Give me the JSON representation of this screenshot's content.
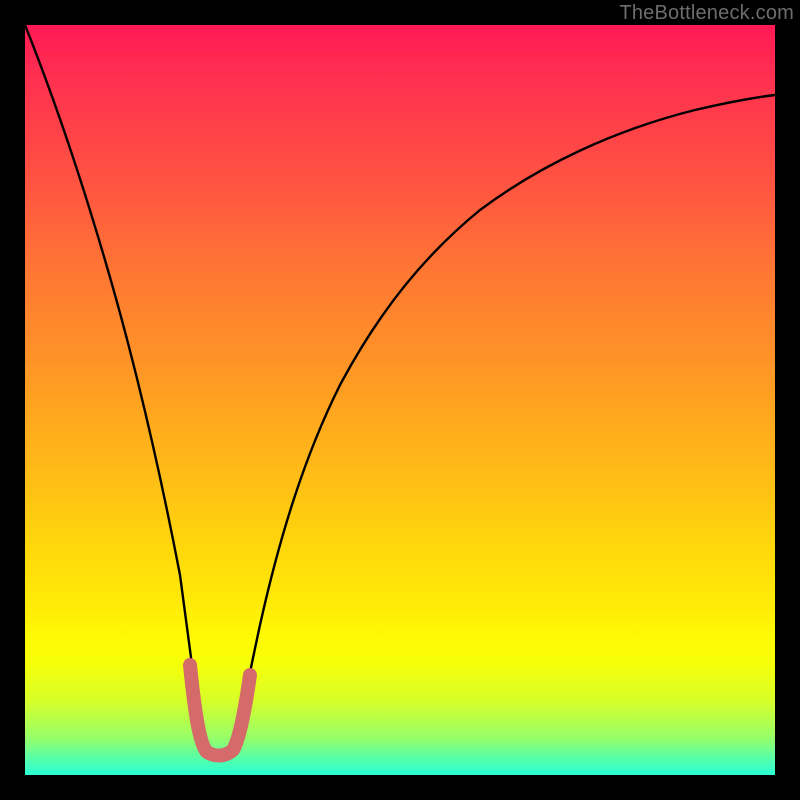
{
  "watermark": "TheBottleneck.com",
  "chart_data": {
    "type": "line",
    "title": "",
    "xlabel": "",
    "ylabel": "",
    "xlim": [
      0,
      100
    ],
    "ylim": [
      0,
      100
    ],
    "series": [
      {
        "name": "bottleneck-curve",
        "color": "#000000",
        "x": [
          0,
          8,
          14,
          18,
          22,
          23,
          24,
          25,
          26,
          27,
          28,
          30,
          34,
          40,
          48,
          56,
          64,
          74,
          86,
          100
        ],
        "values": [
          100,
          75,
          55,
          38,
          14,
          6,
          3,
          3,
          3,
          3,
          6,
          15,
          33,
          50,
          62,
          70,
          76,
          81,
          86,
          90
        ]
      },
      {
        "name": "optimal-zone",
        "color": "#d46a6a",
        "x": [
          22,
          23,
          24,
          25,
          26,
          27,
          28
        ],
        "values": [
          14,
          6,
          3,
          3,
          3,
          3,
          6
        ]
      }
    ],
    "gradient_stops": [
      {
        "pos": 0,
        "color": "#ff1955"
      },
      {
        "pos": 22,
        "color": "#ff5640"
      },
      {
        "pos": 45,
        "color": "#ff9426"
      },
      {
        "pos": 70,
        "color": "#ffd80b"
      },
      {
        "pos": 85,
        "color": "#f6ff09"
      },
      {
        "pos": 100,
        "color": "#29ffd6"
      }
    ]
  }
}
